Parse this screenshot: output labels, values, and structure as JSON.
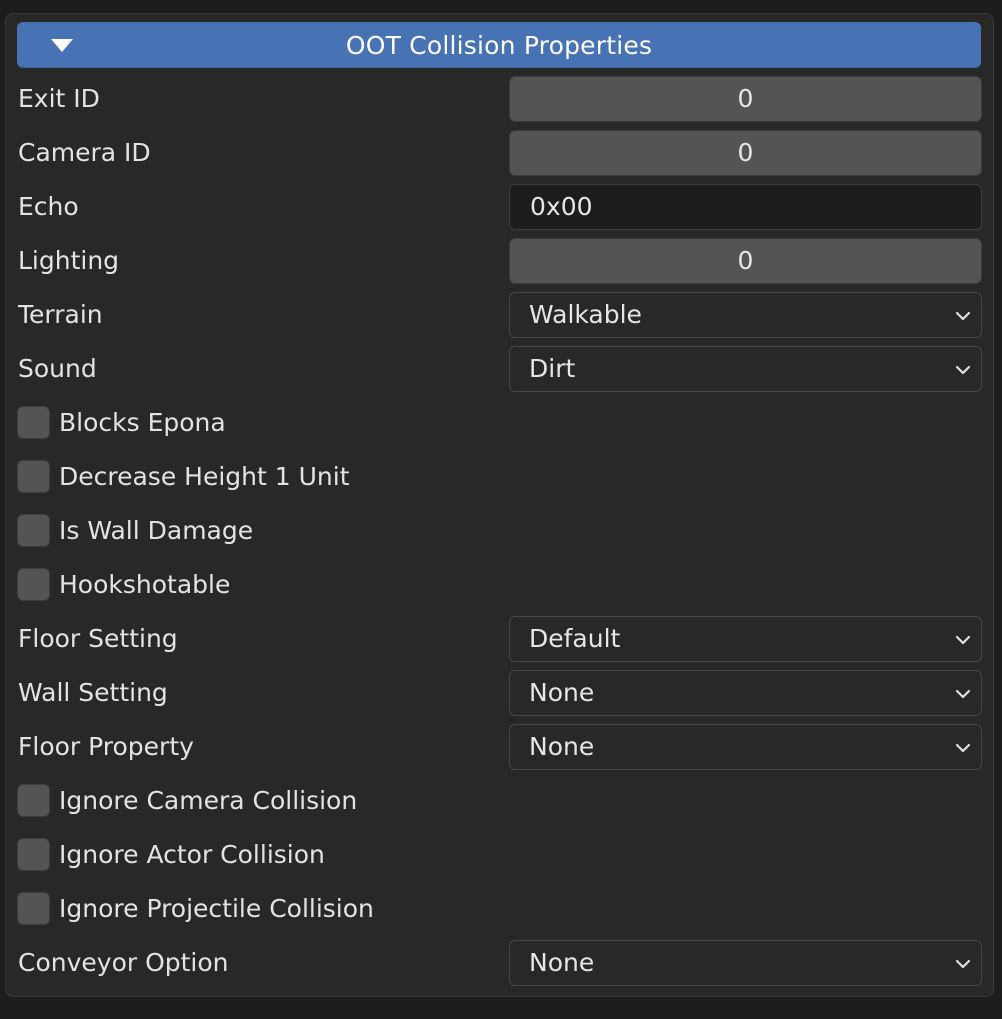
{
  "panel": {
    "title": "OOT Collision Properties",
    "expanded": true
  },
  "fields": {
    "exit_id": {
      "label": "Exit ID",
      "value": "0"
    },
    "camera_id": {
      "label": "Camera ID",
      "value": "0"
    },
    "echo": {
      "label": "Echo",
      "value": "0x00"
    },
    "lighting": {
      "label": "Lighting",
      "value": "0"
    },
    "terrain": {
      "label": "Terrain",
      "value": "Walkable"
    },
    "sound": {
      "label": "Sound",
      "value": "Dirt"
    },
    "blocks_epona": {
      "label": "Blocks Epona",
      "checked": false
    },
    "decrease_height": {
      "label": "Decrease Height 1 Unit",
      "checked": false
    },
    "is_wall_damage": {
      "label": "Is Wall Damage",
      "checked": false
    },
    "hookshotable": {
      "label": "Hookshotable",
      "checked": false
    },
    "floor_setting": {
      "label": "Floor Setting",
      "value": "Default"
    },
    "wall_setting": {
      "label": "Wall Setting",
      "value": "None"
    },
    "floor_property": {
      "label": "Floor Property",
      "value": "None"
    },
    "ignore_camera": {
      "label": "Ignore Camera Collision",
      "checked": false
    },
    "ignore_actor": {
      "label": "Ignore Actor Collision",
      "checked": false
    },
    "ignore_projectile": {
      "label": "Ignore Projectile Collision",
      "checked": false
    },
    "conveyor_option": {
      "label": "Conveyor Option",
      "value": "None"
    }
  },
  "icons": {
    "collapse": "triangle-down-icon",
    "dropdown": "chevron-down-icon"
  },
  "colors": {
    "header": "#4772b3",
    "panel_bg": "#282828",
    "number_field": "#545454",
    "text_field": "#1d1d1d"
  }
}
